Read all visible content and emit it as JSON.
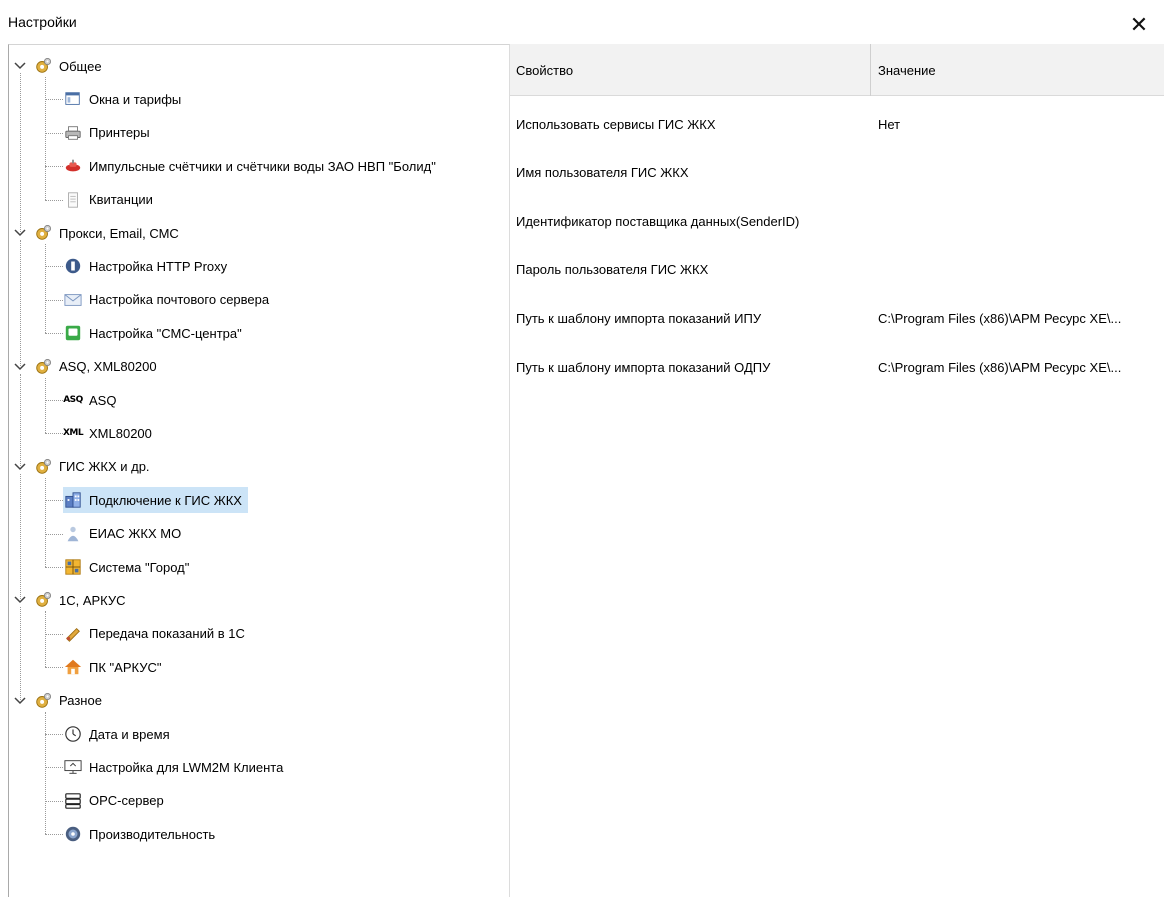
{
  "window": {
    "title": "Настройки",
    "close_glyph": "✕"
  },
  "tree": {
    "groups": [
      {
        "label": "Общее",
        "icon": "gear-group-icon",
        "children": [
          {
            "label": "Окна и тарифы",
            "icon": "window-icon"
          },
          {
            "label": "Принтеры",
            "icon": "printer-icon"
          },
          {
            "label": "Импульсные счётчики и счётчики воды ЗАО НВП \"Болид\"",
            "icon": "meter-icon"
          },
          {
            "label": "Квитанции",
            "icon": "receipt-icon"
          }
        ]
      },
      {
        "label": "Прокси, Email, СМС",
        "icon": "gear-group-icon",
        "children": [
          {
            "label": "Настройка HTTP Proxy",
            "icon": "proxy-icon"
          },
          {
            "label": "Настройка почтового сервера",
            "icon": "mail-icon"
          },
          {
            "label": "Настройка \"СМС-центра\"",
            "icon": "sms-icon"
          }
        ]
      },
      {
        "label": "ASQ, XML80200",
        "icon": "gear-group-icon",
        "children": [
          {
            "label": "ASQ",
            "icon": "asq-icon",
            "icon_text": "ASQ"
          },
          {
            "label": "XML80200",
            "icon": "xml-icon",
            "icon_text": "XML"
          }
        ]
      },
      {
        "label": "ГИС ЖКХ и др.",
        "icon": "gear-group-icon",
        "children": [
          {
            "label": "Подключение к ГИС ЖКХ",
            "icon": "building-icon",
            "selected": true
          },
          {
            "label": "ЕИАС ЖКХ МО",
            "icon": "figure-icon"
          },
          {
            "label": "Система \"Город\"",
            "icon": "grid-icon"
          }
        ]
      },
      {
        "label": "1С, АРКУС",
        "icon": "gear-group-icon",
        "children": [
          {
            "label": "Передача показаний в 1С",
            "icon": "transfer-icon"
          },
          {
            "label": "ПК \"АРКУС\"",
            "icon": "house-icon"
          }
        ]
      },
      {
        "label": "Разное",
        "icon": "gear-group-icon",
        "children": [
          {
            "label": "Дата и время",
            "icon": "clock-icon"
          },
          {
            "label": "Настройка для LWM2M Клиента",
            "icon": "monitor-icon"
          },
          {
            "label": "OPC-сервер",
            "icon": "server-icon"
          },
          {
            "label": "Производительность",
            "icon": "speed-icon"
          }
        ]
      }
    ]
  },
  "grid": {
    "headers": {
      "property": "Свойство",
      "value": "Значение"
    },
    "rows": [
      {
        "property": "Использовать сервисы ГИС ЖКХ",
        "value": "Нет"
      },
      {
        "property": "Имя пользователя ГИС ЖКХ",
        "value": ""
      },
      {
        "property": "Идентификатор поставщика данных(SenderID)",
        "value": ""
      },
      {
        "property": "Пароль пользователя ГИС ЖКХ",
        "value": ""
      },
      {
        "property": "Путь к шаблону импорта показаний ИПУ",
        "value": "C:\\Program Files (x86)\\АРМ Ресурс XE\\..."
      },
      {
        "property": "Путь к шаблону импорта показаний ОДПУ",
        "value": "C:\\Program Files (x86)\\АРМ Ресурс XE\\..."
      }
    ]
  },
  "colors": {
    "selection": "#cce4f7",
    "header_bg": "#f2f2f2",
    "gear": "#d9a227"
  }
}
